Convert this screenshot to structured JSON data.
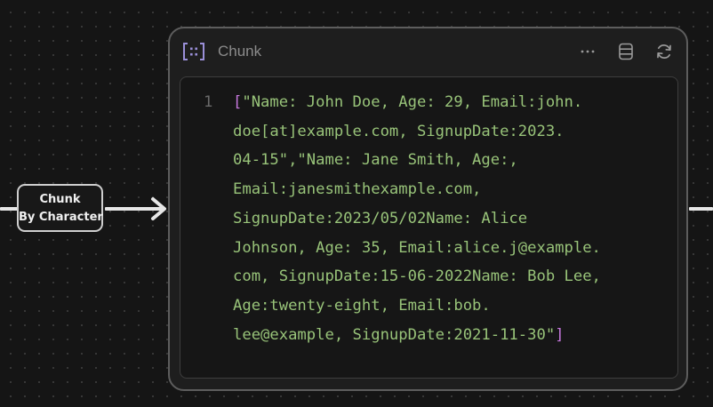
{
  "edge": {
    "label_line1": "Chunk",
    "label_line2": "By Character",
    "line_color": "#e6e6e6"
  },
  "node": {
    "icon": "chunk-brackets-icon",
    "title": "Chunk",
    "actions": [
      {
        "name": "more-options",
        "icon": "ellipsis-icon"
      },
      {
        "name": "document",
        "icon": "document-list-icon"
      },
      {
        "name": "refresh",
        "icon": "refresh-icon"
      }
    ]
  },
  "output": {
    "line_number": "1",
    "open_bracket": "[",
    "close_bracket": "]",
    "lines": [
      "\"Name: John Doe, Age: 29, Email:john.",
      "doe[at]example.com, SignupDate:2023.",
      "04-15\",\"Name: Jane Smith, Age:,",
      "Email:janesmithexample.com,",
      "SignupDate:2023/05/02Name: Alice",
      "Johnson, Age: 35, Email:alice.j@example.",
      "com, SignupDate:15-06-2022Name: Bob Lee,",
      "Age:twenty-eight, Email:bob.",
      "lee@example, SignupDate:2021-11-30\""
    ],
    "string_color": "#98c379",
    "bracket_color": "#c678dd"
  }
}
